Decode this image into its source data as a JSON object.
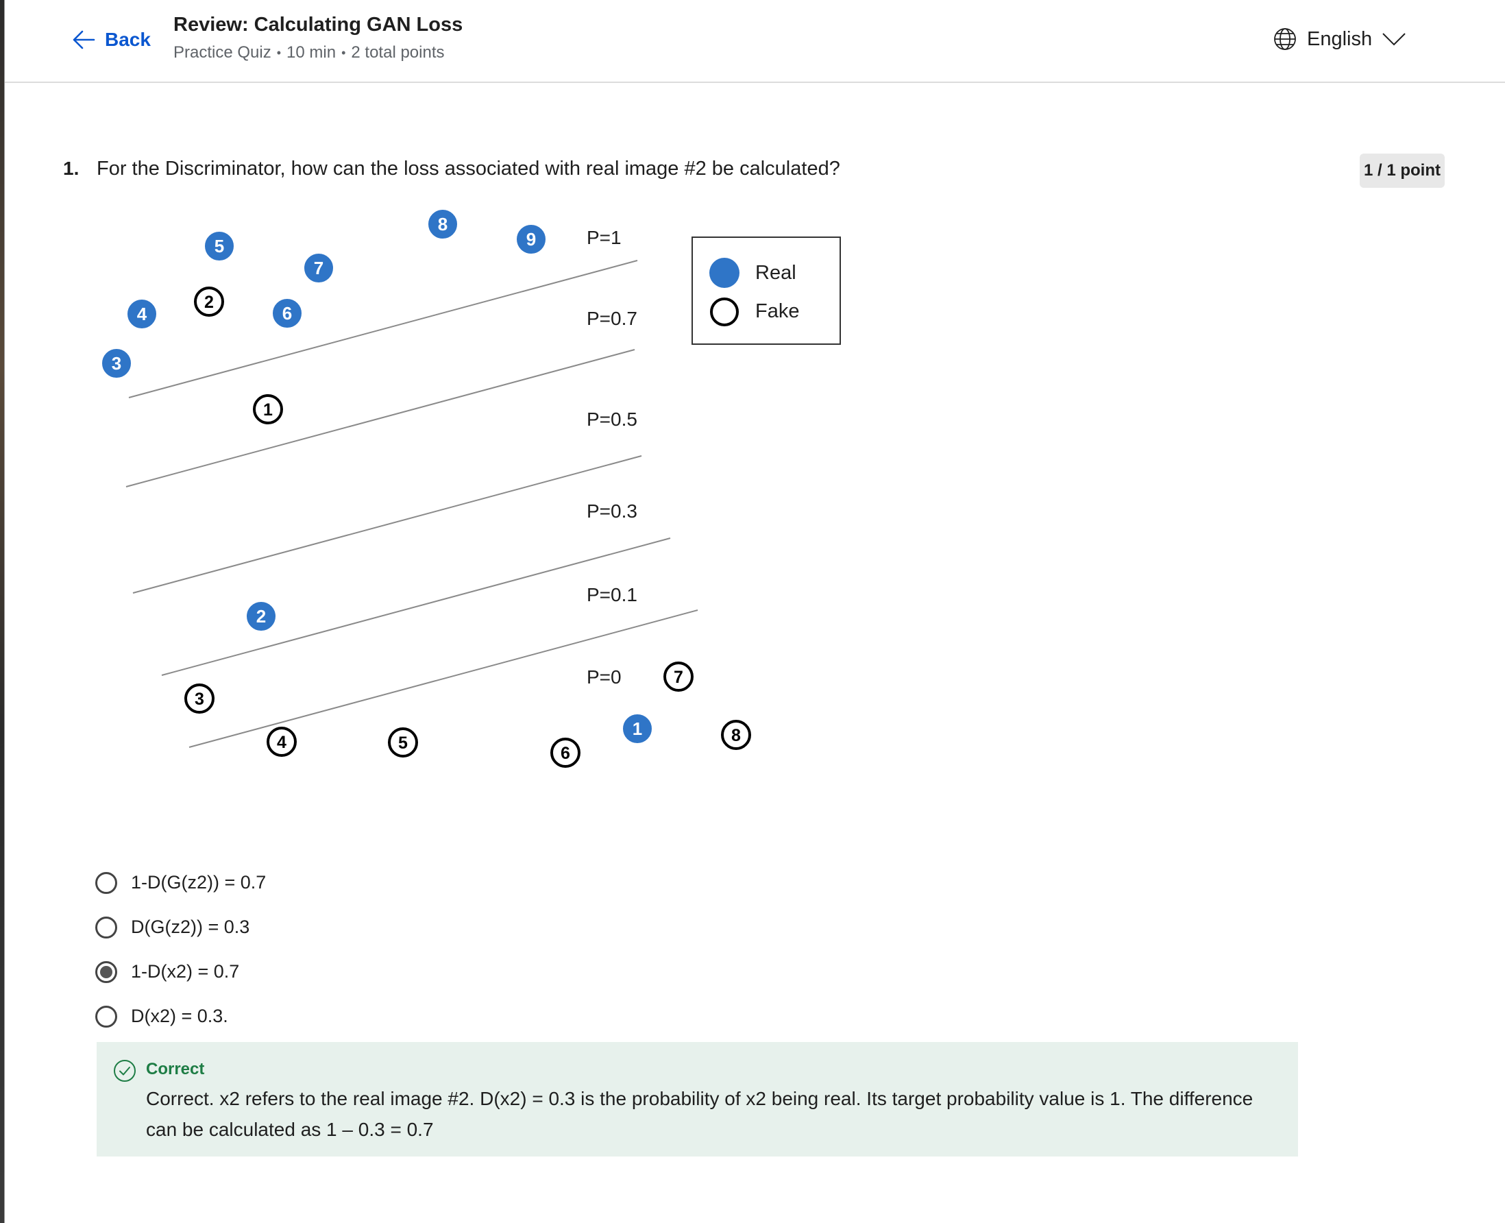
{
  "header": {
    "back_label": "Back",
    "title": "Review: Calculating GAN Loss",
    "meta": [
      "Practice Quiz",
      "10 min",
      "2 total points"
    ],
    "separator": "•",
    "language": "English"
  },
  "question": {
    "number": "1.",
    "text": "For the Discriminator, how can the loss associated with real image #2 be calculated?",
    "points": "1 / 1 point"
  },
  "figure": {
    "probability_labels": [
      "P=1",
      "P=0.7",
      "P=0.5",
      "P=0.3",
      "P=0.1",
      "P=0"
    ],
    "legend": {
      "real": "Real",
      "fake": "Fake"
    },
    "real_markers": [
      "1",
      "2",
      "3",
      "4",
      "5",
      "6",
      "7",
      "8",
      "9"
    ],
    "fake_markers": [
      "1",
      "2",
      "3",
      "4",
      "5",
      "6",
      "7",
      "8"
    ],
    "colors": {
      "real": "#2f75c7",
      "fake_border": "#000000",
      "line": "#8a8a8a"
    }
  },
  "options": [
    {
      "label": "1-D(G(z2)) = 0.7",
      "selected": false
    },
    {
      "label": "D(G(z2)) = 0.3",
      "selected": false
    },
    {
      "label": "1-D(x2) = 0.7",
      "selected": true
    },
    {
      "label": "D(x2) = 0.3.",
      "selected": false
    }
  ],
  "feedback": {
    "status": "Correct",
    "text": "Correct. x2 refers to the real image #2. D(x2) = 0.3 is the probability of x2 being real. Its target probability value is 1. The difference can be calculated as 1 – 0.3 = 0.7",
    "color": "#1e7d45"
  }
}
